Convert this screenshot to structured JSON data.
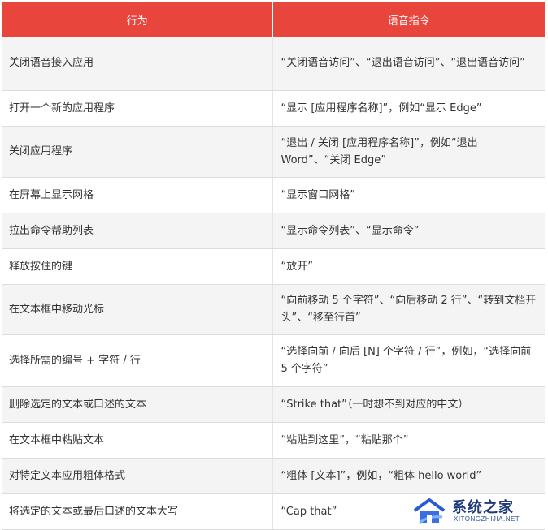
{
  "table": {
    "headers": [
      "行为",
      "语音指令"
    ],
    "rows": [
      {
        "action": "关闭语音接入应用",
        "command": "“关闭语音访问”、“退出语音访问”、“退出语音访问”"
      },
      {
        "action": "打开一个新的应用程序",
        "command": "“显示 [应用程序名称]”，例如“显示 Edge”"
      },
      {
        "action": "关闭应用程序",
        "command": "“退出 / 关闭 [应用程序名称]”，例如“退出 Word”、“关闭 Edge”"
      },
      {
        "action": "在屏幕上显示网格",
        "command": "“显示窗口网格”"
      },
      {
        "action": "拉出命令帮助列表",
        "command": "“显示命令列表”、“显示命令”"
      },
      {
        "action": "释放按住的键",
        "command": "“放开”"
      },
      {
        "action": "在文本框中移动光标",
        "command": "“向前移动 5 个字符”、“向后移动 2 行”、“转到文档开头”、“移至行首”"
      },
      {
        "action": "选择所需的编号 + 字符 / 行",
        "command": "“选择向前 / 向后 [N] 个字符 / 行”，例如，“选择向前 5 个字符”"
      },
      {
        "action": "删除选定的文本或口述的文本",
        "command": "“Strike that”（一时想不到对应的中文）"
      },
      {
        "action": "在文本框中粘贴文本",
        "command": "“粘贴到这里”，“粘贴那个”"
      },
      {
        "action": "对特定文本应用粗体格式",
        "command": "“粗体 [文本]”，例如，“粗体 hello world”"
      },
      {
        "action": "将选定的文本或最后口述的文本大写",
        "command": "“Cap that”"
      }
    ]
  },
  "watermark": {
    "title": "系统之家",
    "subtitle": "XITONGZHIJIA.NET",
    "icon": "house-logo-icon"
  },
  "colors": {
    "header_bg": "#e8453c",
    "header_text": "#ffffff",
    "row_alt_bg": "#f4f4f4",
    "text": "#333333"
  }
}
